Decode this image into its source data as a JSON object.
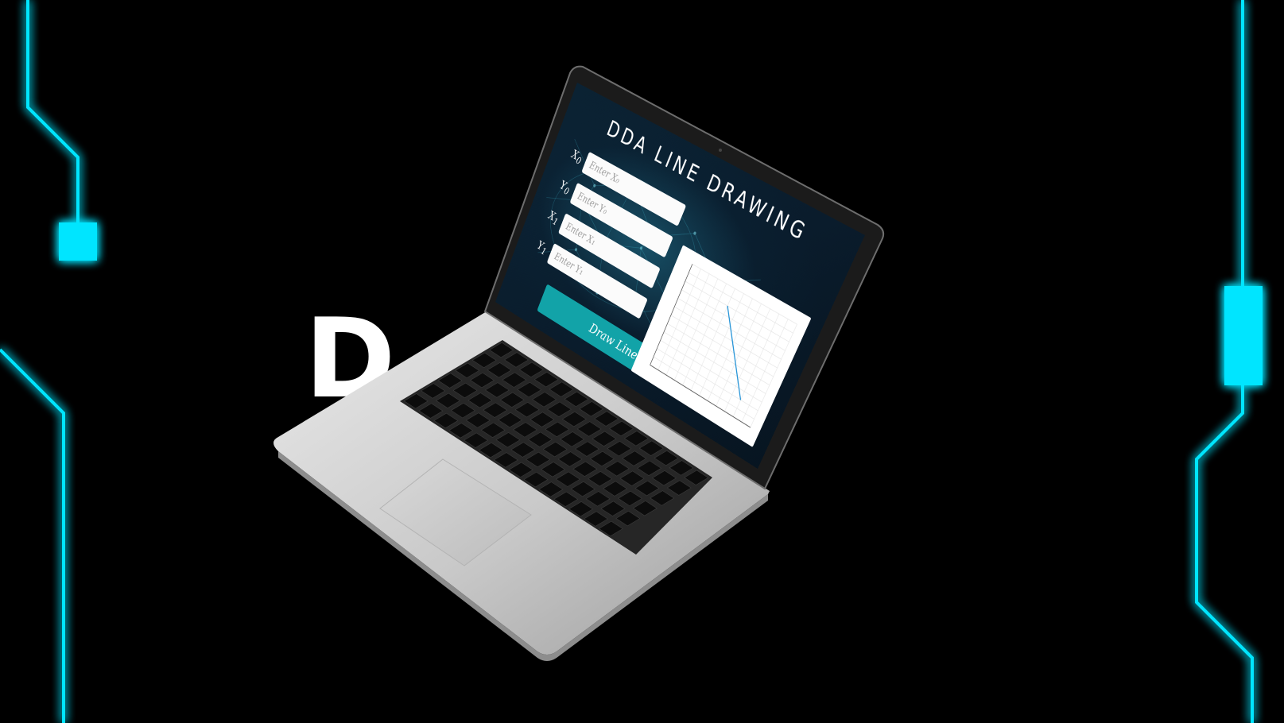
{
  "background": {
    "title_text": "DDA Line Drawing",
    "overlay_text": "D           en",
    "glow_color": "#00e5ff",
    "base_color": "#000000"
  },
  "app": {
    "title": "DDA Line Drawing",
    "fields": [
      {
        "label": "X",
        "sub": "0",
        "placeholder": "Enter X₀"
      },
      {
        "label": "Y",
        "sub": "0",
        "placeholder": "Enter Y₀"
      },
      {
        "label": "X",
        "sub": "1",
        "placeholder": "Enter X₁"
      },
      {
        "label": "Y",
        "sub": "1",
        "placeholder": "Enter Y₁"
      }
    ],
    "button_label": "Draw Line",
    "accent_color": "#12a3a8"
  },
  "chart_data": {
    "type": "line",
    "title": "",
    "xlabel": "",
    "ylabel": "",
    "series": [
      {
        "color": "#1e90d6",
        "x": [
          2.5,
          5
        ],
        "y": [
          5,
          1
        ]
      }
    ],
    "xlim": [
      0,
      6
    ],
    "ylim": [
      0,
      6
    ],
    "grid": true
  }
}
